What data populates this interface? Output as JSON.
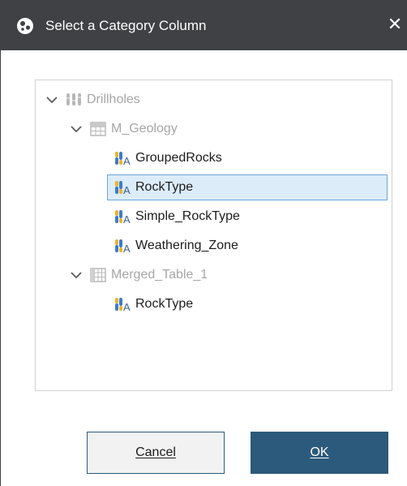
{
  "dialog": {
    "title": "Select a Category Column",
    "close_glyph": "✕"
  },
  "tree": {
    "root": {
      "label": "Drillholes",
      "icon": "drillholes-icon",
      "expanded": true
    },
    "tables": [
      {
        "label": "M_Geology",
        "icon": "table-icon",
        "expanded": true,
        "columns": [
          {
            "label": "GroupedRocks",
            "icon": "category-column-icon",
            "selected": false
          },
          {
            "label": "RockType",
            "icon": "category-column-icon",
            "selected": true
          },
          {
            "label": "Simple_RockType",
            "icon": "category-column-icon",
            "selected": false
          },
          {
            "label": "Weathering_Zone",
            "icon": "category-column-icon",
            "selected": false
          }
        ]
      },
      {
        "label": "Merged_Table_1",
        "icon": "merged-table-icon",
        "expanded": true,
        "columns": [
          {
            "label": "RockType",
            "icon": "category-column-icon",
            "selected": false
          }
        ]
      }
    ]
  },
  "buttons": {
    "cancel_label": "Cancel",
    "ok_label": "OK"
  },
  "colors": {
    "titlebar": "#3f4145",
    "accent": "#2c5a7c",
    "selection_fill": "#dcecf9",
    "selection_border": "#6aa7dc",
    "disabled_text": "#a6a6a6"
  }
}
